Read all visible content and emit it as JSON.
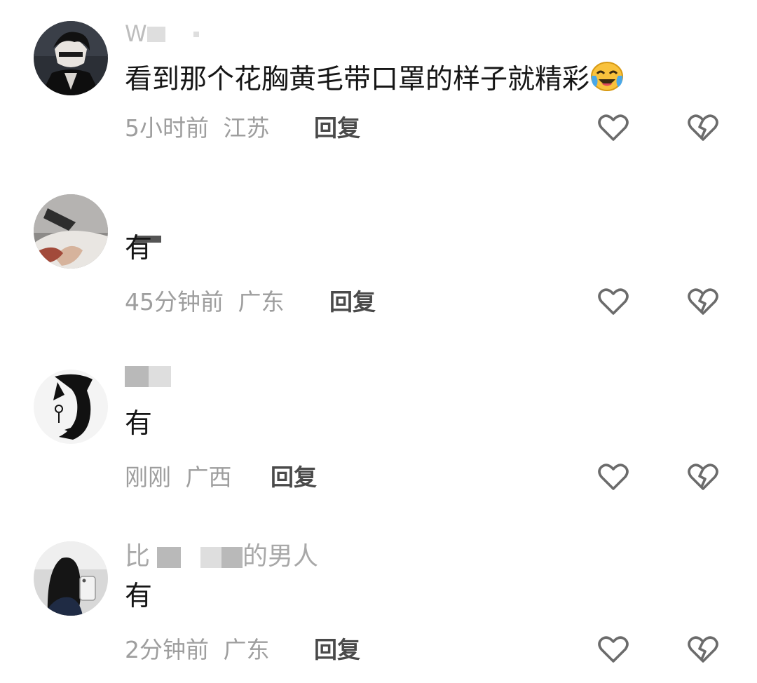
{
  "comments": [
    {
      "username": "W",
      "text": "看到那个花胸黄毛带口罩的样子就精彩",
      "emoji": "crying-laughing-emoji",
      "time": "5小时前",
      "location": "江苏",
      "reply": "回复"
    },
    {
      "username": "",
      "text": "有",
      "time": "45分钟前",
      "location": "广东",
      "reply": "回复"
    },
    {
      "username": "",
      "text": "有",
      "time": "刚刚",
      "location": "广西",
      "reply": "回复"
    },
    {
      "username_start": "比",
      "username_end": "的男人",
      "text": "有",
      "time": "2分钟前",
      "location": "广东",
      "reply": "回复"
    }
  ],
  "icons": {
    "like": "heart-outline-icon",
    "dislike": "broken-heart-outline-icon"
  },
  "colors": {
    "text": "#161616",
    "meta": "#9e9e9e",
    "reply": "#4a4a4a",
    "icon": "#6b6b6b"
  }
}
